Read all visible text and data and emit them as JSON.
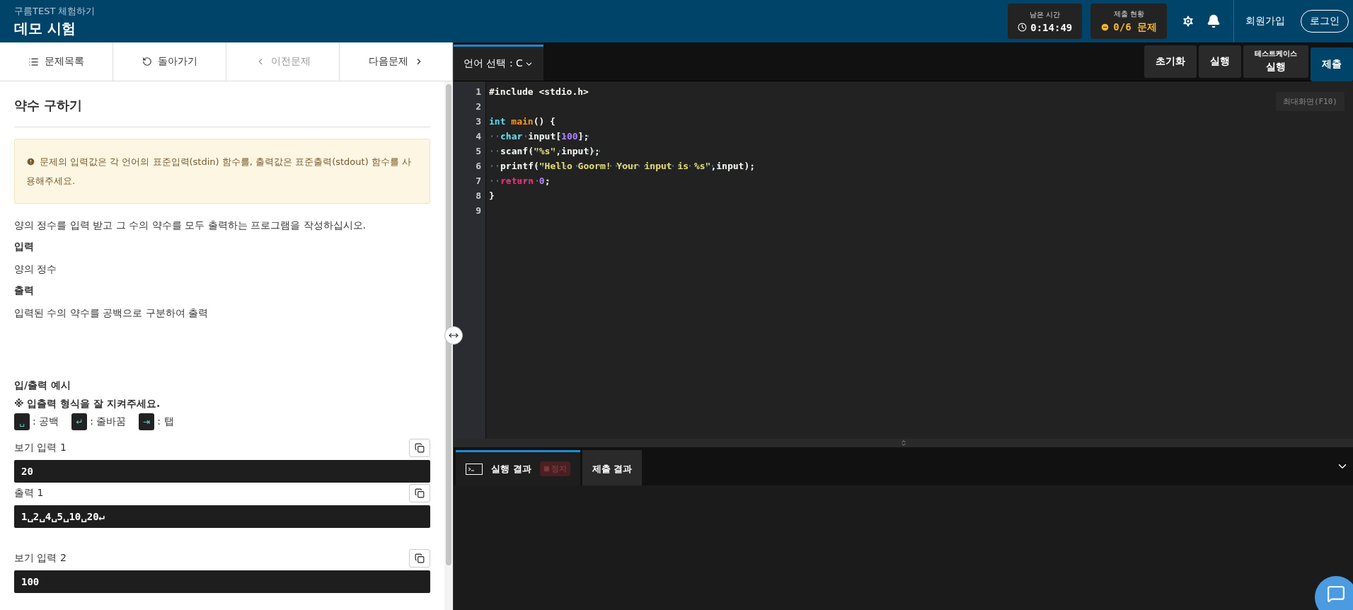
{
  "header": {
    "subtitle": "구름TEST 체험하기",
    "title": "데모 시험",
    "timer": {
      "label": "남은 시간",
      "value": "0:14:49"
    },
    "submission": {
      "label": "제출 현황",
      "value": "0/6 문제"
    },
    "signup": "회원가입",
    "login": "로그인"
  },
  "nav": [
    {
      "kind": "list",
      "label": "문제목록",
      "disabled": false
    },
    {
      "kind": "back",
      "label": "돌아가기",
      "disabled": false
    },
    {
      "kind": "prev",
      "label": "이전문제",
      "disabled": true
    },
    {
      "kind": "next",
      "label": "다음문제",
      "disabled": false
    }
  ],
  "problem": {
    "title": "약수 구하기",
    "notice": "문제의 입력값은 각 언어의 표준입력(stdin) 함수를, 출력값은 표준출력(stdout) 함수를 사용해주세요.",
    "description": "양의 정수를 입력 받고 그 수의 약수를 모두 출력하는 프로그램을 작성하십시오.",
    "sections": [
      {
        "heading": "입력",
        "body": "양의 정수"
      },
      {
        "heading": "출력",
        "body": "입력된 수의 약수를 공백으로 구분하여 출력"
      }
    ],
    "examples_heading": "입/출력 예시",
    "format_note": "※ 입출력 형식을 잘 지켜주세요.",
    "legend": [
      {
        "key": "␣",
        "label": ": 공백"
      },
      {
        "key": "↵",
        "label": ": 줄바꿈"
      },
      {
        "key": "⇥",
        "label": ": 탭"
      }
    ],
    "examples": [
      {
        "label": "보기 입력 1",
        "value": "20"
      },
      {
        "label": "출력 1",
        "value": "1␣2␣4␣5␣10␣20↵"
      },
      {
        "label": "보기 입력 2",
        "value": "100"
      }
    ]
  },
  "editor": {
    "language": "언어 선택 : C",
    "buttons": [
      {
        "kind": "plain",
        "label": "초기화"
      },
      {
        "kind": "plain",
        "label": "실행"
      },
      {
        "kind": "stacked",
        "top": "테스트케이스",
        "label": "실행"
      },
      {
        "kind": "primary",
        "label": "제출"
      }
    ],
    "maximize": "최대화면(F10)",
    "lines": [
      {
        "number": "1",
        "tokens": [
          {
            "kind": "plain",
            "text": "#include <stdio.h>"
          }
        ]
      },
      {
        "number": "2"
      },
      {
        "number": "3",
        "tokens": [
          {
            "kind": "type",
            "text": "int "
          },
          {
            "kind": "func",
            "text": "main"
          },
          {
            "kind": "plain",
            "text": "() {"
          }
        ]
      },
      {
        "number": "4",
        "indent": true,
        "tokens": [
          {
            "kind": "type",
            "text": "char "
          },
          {
            "kind": "plain",
            "text": "input["
          },
          {
            "kind": "number",
            "text": "100"
          },
          {
            "kind": "plain",
            "text": "];"
          }
        ]
      },
      {
        "number": "5",
        "indent": true,
        "tokens": [
          {
            "kind": "plain",
            "text": "scanf("
          },
          {
            "kind": "string",
            "text": "\"%s\""
          },
          {
            "kind": "plain",
            "text": ",input);"
          }
        ]
      },
      {
        "number": "6",
        "indent": true,
        "tokens": [
          {
            "kind": "plain",
            "text": "printf("
          },
          {
            "kind": "string",
            "text": "\"Hello Goorm! Your input is %s\""
          },
          {
            "kind": "plain",
            "text": ",input);"
          }
        ]
      },
      {
        "number": "7",
        "indent": true,
        "tokens": [
          {
            "kind": "keyword",
            "text": "return "
          },
          {
            "kind": "number",
            "text": "0"
          },
          {
            "kind": "plain",
            "text": ";"
          }
        ]
      },
      {
        "number": "8",
        "tokens": [
          {
            "kind": "plain",
            "text": "}"
          }
        ]
      },
      {
        "number": "9"
      }
    ]
  },
  "results": {
    "tabs": [
      {
        "label": "실행 결과",
        "selected": true,
        "stop": {
          "label": "정지",
          "disabled": true
        }
      },
      {
        "label": "제출 결과",
        "selected": false
      }
    ]
  }
}
